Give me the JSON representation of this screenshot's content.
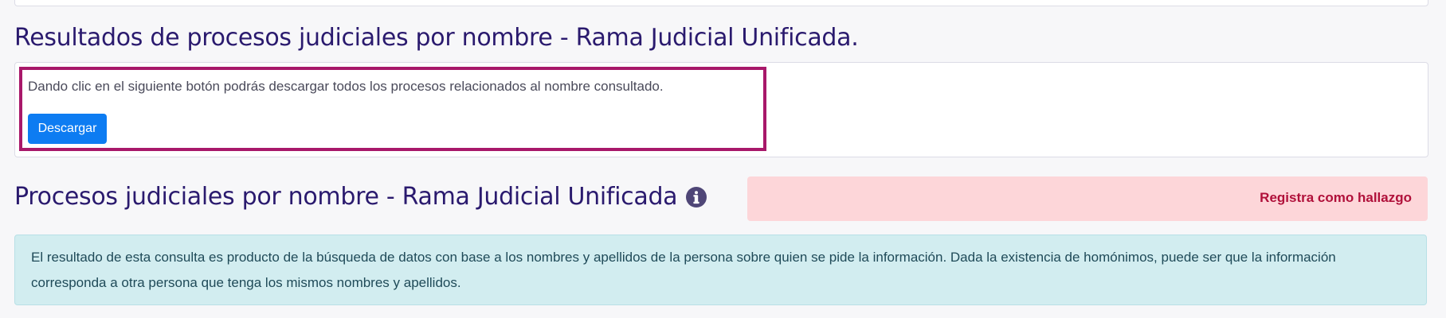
{
  "results_section": {
    "title": "Resultados de procesos judiciales por nombre - Rama Judicial Unificada.",
    "download_text": "Dando clic en el siguiente botón podrás descargar todos los procesos relacionados al nombre consultado.",
    "download_button_label": "Descargar"
  },
  "processes_section": {
    "title": "Procesos judiciales por nombre - Rama Judicial Unificada",
    "info_icon": "info-circle-icon",
    "status_text": "Registra como hallazgo",
    "notice_text": "El resultado de esta consulta es producto de la búsqueda de datos con base a los nombres y apellidos de la persona sobre quien se pide la información. Dada la existencia de homónimos, puede ser que la información corresponda a otra persona que tenga los mismos nombres y apellidos."
  },
  "colors": {
    "title": "#2a1a6e",
    "highlight_border": "#a8186a",
    "button": "#0d7cf2",
    "status_background": "#fdd6d9",
    "status_text": "#b0103a",
    "notice_background": "#d2edf0"
  }
}
